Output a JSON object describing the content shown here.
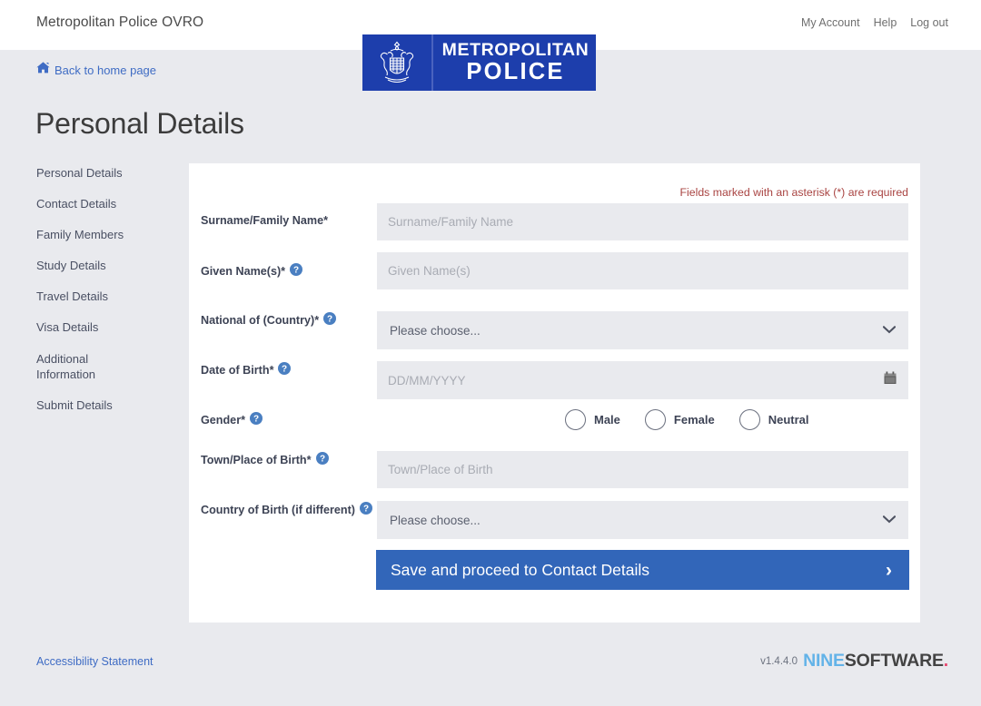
{
  "header": {
    "brand_title": "Metropolitan Police OVRO",
    "nav": [
      {
        "label": "My Account"
      },
      {
        "label": "Help"
      },
      {
        "label": "Log out"
      }
    ],
    "logo": {
      "line1": "METROPOLITAN",
      "line2": "POLICE",
      "crest_icon": "royal-crest-icon",
      "background_color": "#1d3eac"
    },
    "back_link": {
      "label": "Back to home page",
      "icon": "home-icon",
      "color": "#3f6cc4"
    }
  },
  "page": {
    "title": "Personal Details"
  },
  "sidebar": {
    "items": [
      {
        "label": "Personal Details"
      },
      {
        "label": "Contact Details"
      },
      {
        "label": "Family Members"
      },
      {
        "label": "Study Details"
      },
      {
        "label": "Travel Details"
      },
      {
        "label": "Visa Details"
      },
      {
        "label": "Additional Information"
      },
      {
        "label": "Submit Details"
      }
    ]
  },
  "form": {
    "required_note": "Fields marked with an asterisk (*) are required",
    "required_note_color": "#a94442",
    "fields": [
      {
        "label": "Surname/Family Name*",
        "has_help": false,
        "type": "text",
        "placeholder": "Surname/Family Name",
        "value": ""
      },
      {
        "label": "Given Name(s)*",
        "has_help": true,
        "type": "text",
        "placeholder": "Given Name(s)",
        "value": ""
      },
      {
        "label": "National of (Country)*",
        "has_help": true,
        "type": "select",
        "placeholder": "Please choose...",
        "value": "Please choose..."
      },
      {
        "label": "Date of Birth*",
        "has_help": true,
        "type": "date",
        "placeholder": "DD/MM/YYYY",
        "value": ""
      },
      {
        "label": "Gender*",
        "has_help": true,
        "type": "radio",
        "options": [
          {
            "label": "Male",
            "selected": false
          },
          {
            "label": "Female",
            "selected": false
          },
          {
            "label": "Neutral",
            "selected": false
          }
        ]
      },
      {
        "label": "Town/Place of Birth*",
        "has_help": true,
        "type": "text",
        "placeholder": "Town/Place of Birth",
        "value": ""
      },
      {
        "label": "Country of Birth (if different)",
        "has_help": true,
        "type": "select",
        "placeholder": "Please choose...",
        "value": "Please choose..."
      }
    ],
    "submit": {
      "label": "Save and proceed to Contact Details",
      "arrow_icon": "chevron-right-icon",
      "color": "#3266b9"
    }
  },
  "footer": {
    "accessibility_link": "Accessibility Statement",
    "version": "v1.4.4.0",
    "vendor": {
      "part1": "NINE",
      "part2": "SOFTWARE",
      "part3": ".",
      "color1": "#63b3e8",
      "color2": "#434343",
      "color3": "#e8456e"
    }
  }
}
